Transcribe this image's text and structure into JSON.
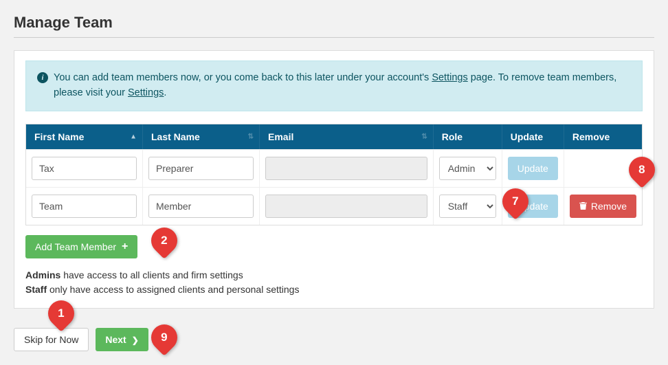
{
  "page": {
    "title": "Manage Team"
  },
  "alert": {
    "text_prefix": "You can add team members now, or you come back to this later under your account's ",
    "settings_link": "Settings",
    "text_suffix": " page. To remove team members, please visit your ",
    "settings_link2": "Settings",
    "text_end": "."
  },
  "table": {
    "headers": {
      "first_name": "First Name",
      "last_name": "Last Name",
      "email": "Email",
      "role": "Role",
      "update": "Update",
      "remove": "Remove"
    },
    "rows": [
      {
        "first_name": "Tax",
        "last_name": "Preparer",
        "email": "",
        "role": "Admin",
        "update_label": "Update",
        "remove_label": ""
      },
      {
        "first_name": "Team",
        "last_name": "Member",
        "email": "",
        "role": "Staff",
        "update_label": "Update",
        "remove_label": "Remove"
      }
    ],
    "role_options": [
      "Admin",
      "Staff"
    ]
  },
  "buttons": {
    "add_member": "Add Team Member",
    "skip": "Skip for Now",
    "next": "Next"
  },
  "descriptions": {
    "admins_bold": "Admins",
    "admins_text": " have access to all clients and firm settings",
    "staff_bold": "Staff",
    "staff_text": " only have access to assigned clients and personal settings"
  },
  "annotations": {
    "a1": "1",
    "a2": "2",
    "a7": "7",
    "a8": "8",
    "a9": "9"
  }
}
